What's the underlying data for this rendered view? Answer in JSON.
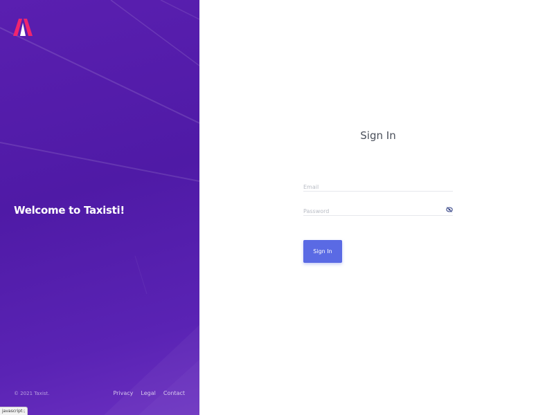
{
  "brand": {
    "welcome_text": "Welcome to Taxisti!",
    "logo_icon": "taxisti-logo-icon",
    "logo_color": "#f0256e"
  },
  "footer": {
    "copyright": "© 2021 Taxist.",
    "links": [
      "Privacy",
      "Legal",
      "Contact"
    ]
  },
  "form": {
    "title": "Sign In",
    "email_placeholder": "Email",
    "password_placeholder": "Password",
    "password_toggle_icon": "eye-icon",
    "submit_label": "Sign In"
  },
  "status": {
    "corner_label": "javascript:;"
  },
  "colors": {
    "panel_purple": "#5a1fb0",
    "button_blue": "#5a6ae4"
  }
}
